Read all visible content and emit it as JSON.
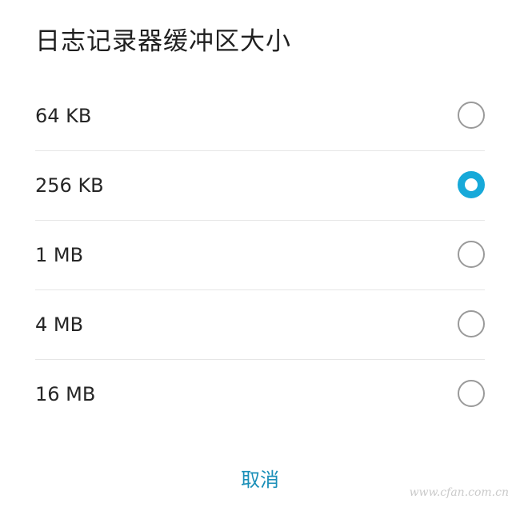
{
  "dialog": {
    "title": "日志记录器缓冲区大小",
    "options": [
      {
        "label": "64 KB",
        "selected": false
      },
      {
        "label": "256 KB",
        "selected": true
      },
      {
        "label": "1 MB",
        "selected": false
      },
      {
        "label": "4 MB",
        "selected": false
      },
      {
        "label": "16 MB",
        "selected": false
      }
    ],
    "cancel_label": "取消"
  },
  "watermark": "www.cfan.com.cn",
  "colors": {
    "accent": "#17a9d9",
    "cancel_text": "#1a8fb8",
    "divider": "#e6e6e6",
    "radio_unchecked": "#9a9a9a"
  }
}
